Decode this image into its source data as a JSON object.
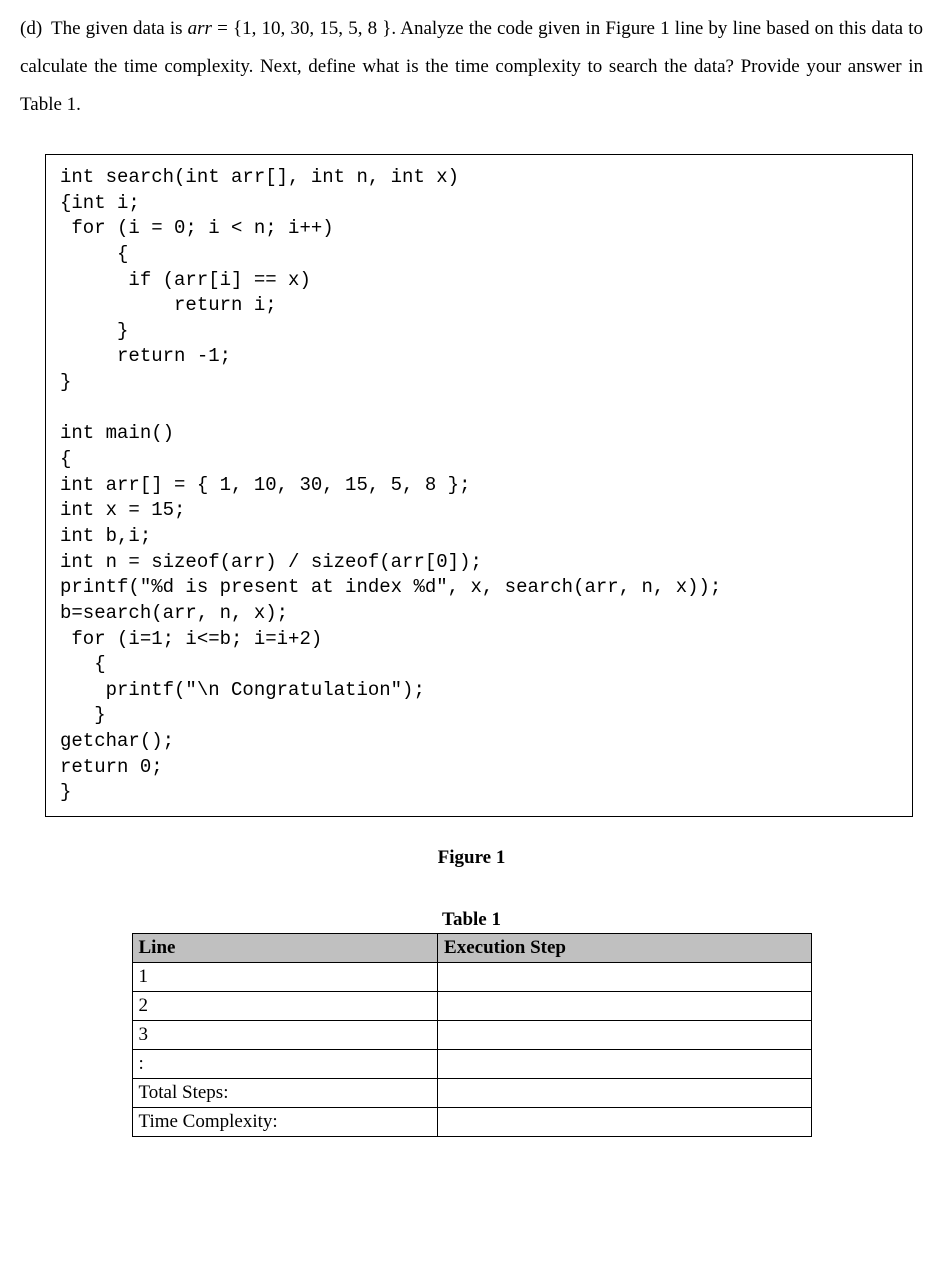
{
  "question": {
    "label": "(d)",
    "text_part1": "The given data is ",
    "arr_var": "arr",
    "text_part2": " = {1, 10, 30, 15, 5, 8 }. Analyze the code given in Figure 1 line by line based on this data to calculate the time complexity. Next, define what is the time complexity to search the data? Provide your answer in Table 1."
  },
  "code": "int search(int arr[], int n, int x)\n{int i;\n for (i = 0; i < n; i++)\n     {\n      if (arr[i] == x)\n          return i;\n     }\n     return -1;\n}\n\nint main()\n{\nint arr[] = { 1, 10, 30, 15, 5, 8 };\nint x = 15;\nint b,i;\nint n = sizeof(arr) / sizeof(arr[0]);\nprintf(\"%d is present at index %d\", x, search(arr, n, x));\nb=search(arr, n, x);\n for (i=1; i<=b; i=i+2)\n   {\n    printf(\"\\n Congratulation\");\n   }\ngetchar();\nreturn 0;\n}",
  "figure_caption": "Figure 1",
  "table": {
    "caption": "Table 1",
    "headers": {
      "line": "Line",
      "exec": "Execution Step"
    },
    "rows": [
      {
        "line": "1",
        "exec": ""
      },
      {
        "line": "2",
        "exec": ""
      },
      {
        "line": "3",
        "exec": ""
      },
      {
        "line": ":",
        "exec": ""
      },
      {
        "line": "Total Steps:",
        "exec": ""
      },
      {
        "line": "Time Complexity:",
        "exec": ""
      }
    ]
  }
}
